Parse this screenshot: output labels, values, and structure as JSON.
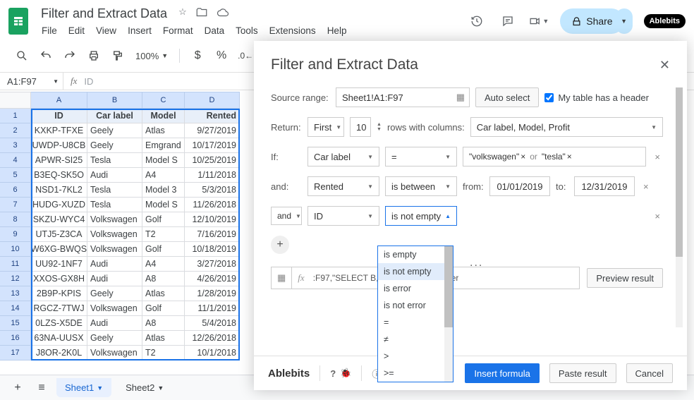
{
  "doc": {
    "title": "Filter and Extract Data"
  },
  "menu": [
    "File",
    "Edit",
    "View",
    "Insert",
    "Format",
    "Data",
    "Tools",
    "Extensions",
    "Help"
  ],
  "share_label": "Share",
  "badge": "Ablebits",
  "toolbar": {
    "zoom": "100%",
    "symbol_dollar": "$",
    "symbol_percent": "%"
  },
  "fxbar": {
    "range": "A1:F97",
    "text": "ID"
  },
  "columns": [
    "A",
    "B",
    "C",
    "D"
  ],
  "headers": [
    "ID",
    "Car label",
    "Model",
    "Rented"
  ],
  "rows": [
    [
      "KXKP-TFXE",
      "Geely",
      "Atlas",
      "9/27/2019"
    ],
    [
      "UWDP-U8CB",
      "Geely",
      "Emgrand",
      "10/17/2019"
    ],
    [
      "APWR-SI25",
      "Tesla",
      "Model S",
      "10/25/2019"
    ],
    [
      "B3EQ-SK5O",
      "Audi",
      "A4",
      "1/11/2018"
    ],
    [
      "NSD1-7KL2",
      "Tesla",
      "Model 3",
      "5/3/2018"
    ],
    [
      "HUDG-XUZD",
      "Tesla",
      "Model S",
      "11/26/2018"
    ],
    [
      "SKZU-WYC4",
      "Volkswagen",
      "Golf",
      "12/10/2019"
    ],
    [
      "UTJ5-Z3CA",
      "Volkswagen",
      "T2",
      "7/16/2019"
    ],
    [
      "W6XG-BWQS",
      "Volkswagen",
      "Golf",
      "10/18/2019"
    ],
    [
      "UU92-1NF7",
      "Audi",
      "A4",
      "3/27/2018"
    ],
    [
      "XXOS-GX8H",
      "Audi",
      "A8",
      "4/26/2019"
    ],
    [
      "2B9P-KPIS",
      "Geely",
      "Atlas",
      "1/28/2019"
    ],
    [
      "RGCZ-7TWJ",
      "Volkswagen",
      "Golf",
      "11/1/2019"
    ],
    [
      "0LZS-X5DE",
      "Audi",
      "A8",
      "5/4/2018"
    ],
    [
      "63NA-UUSX",
      "Geely",
      "Atlas",
      "12/26/2018"
    ],
    [
      "J8OR-2K0L",
      "Volkswagen",
      "T2",
      "10/1/2018"
    ]
  ],
  "panel": {
    "title": "Filter and Extract Data",
    "labels": {
      "source_range": "Source range:",
      "autoselect": "Auto select",
      "has_header": "My table has a header",
      "return": "Return:",
      "rows_cols": "rows with columns:",
      "if": "If:",
      "and1": "and:",
      "and2": "and",
      "from": "from:",
      "to": "to:",
      "or": "or"
    },
    "source_range_value": "Sheet1!A1:F97",
    "return_mode": "First",
    "return_n": "10",
    "return_cols": "Car label, Model, Profit",
    "cond1": {
      "col": "Car label",
      "op": "=",
      "tags": [
        "\"volkswagen\"",
        "\"tesla\""
      ]
    },
    "cond2": {
      "col": "Rented",
      "op": "is between",
      "from": "01/01/2019",
      "to": "12/31/2019"
    },
    "cond3": {
      "col": "ID",
      "op": "is not empty"
    },
    "dropdown_options": [
      "is empty",
      "is not empty",
      "is error",
      "is not error",
      "=",
      "≠",
      ">",
      ">="
    ],
    "formula_text": ":F97,\"SELECT B, C, F WHERE ((lower",
    "formula_dots": "...",
    "preview": "Preview result",
    "insert": "Insert formula",
    "paste": "Paste result",
    "cancel": "Cancel",
    "brand": "Ablebits",
    "help": "?"
  },
  "sheets": {
    "s1": "Sheet1",
    "s2": "Sheet2"
  }
}
